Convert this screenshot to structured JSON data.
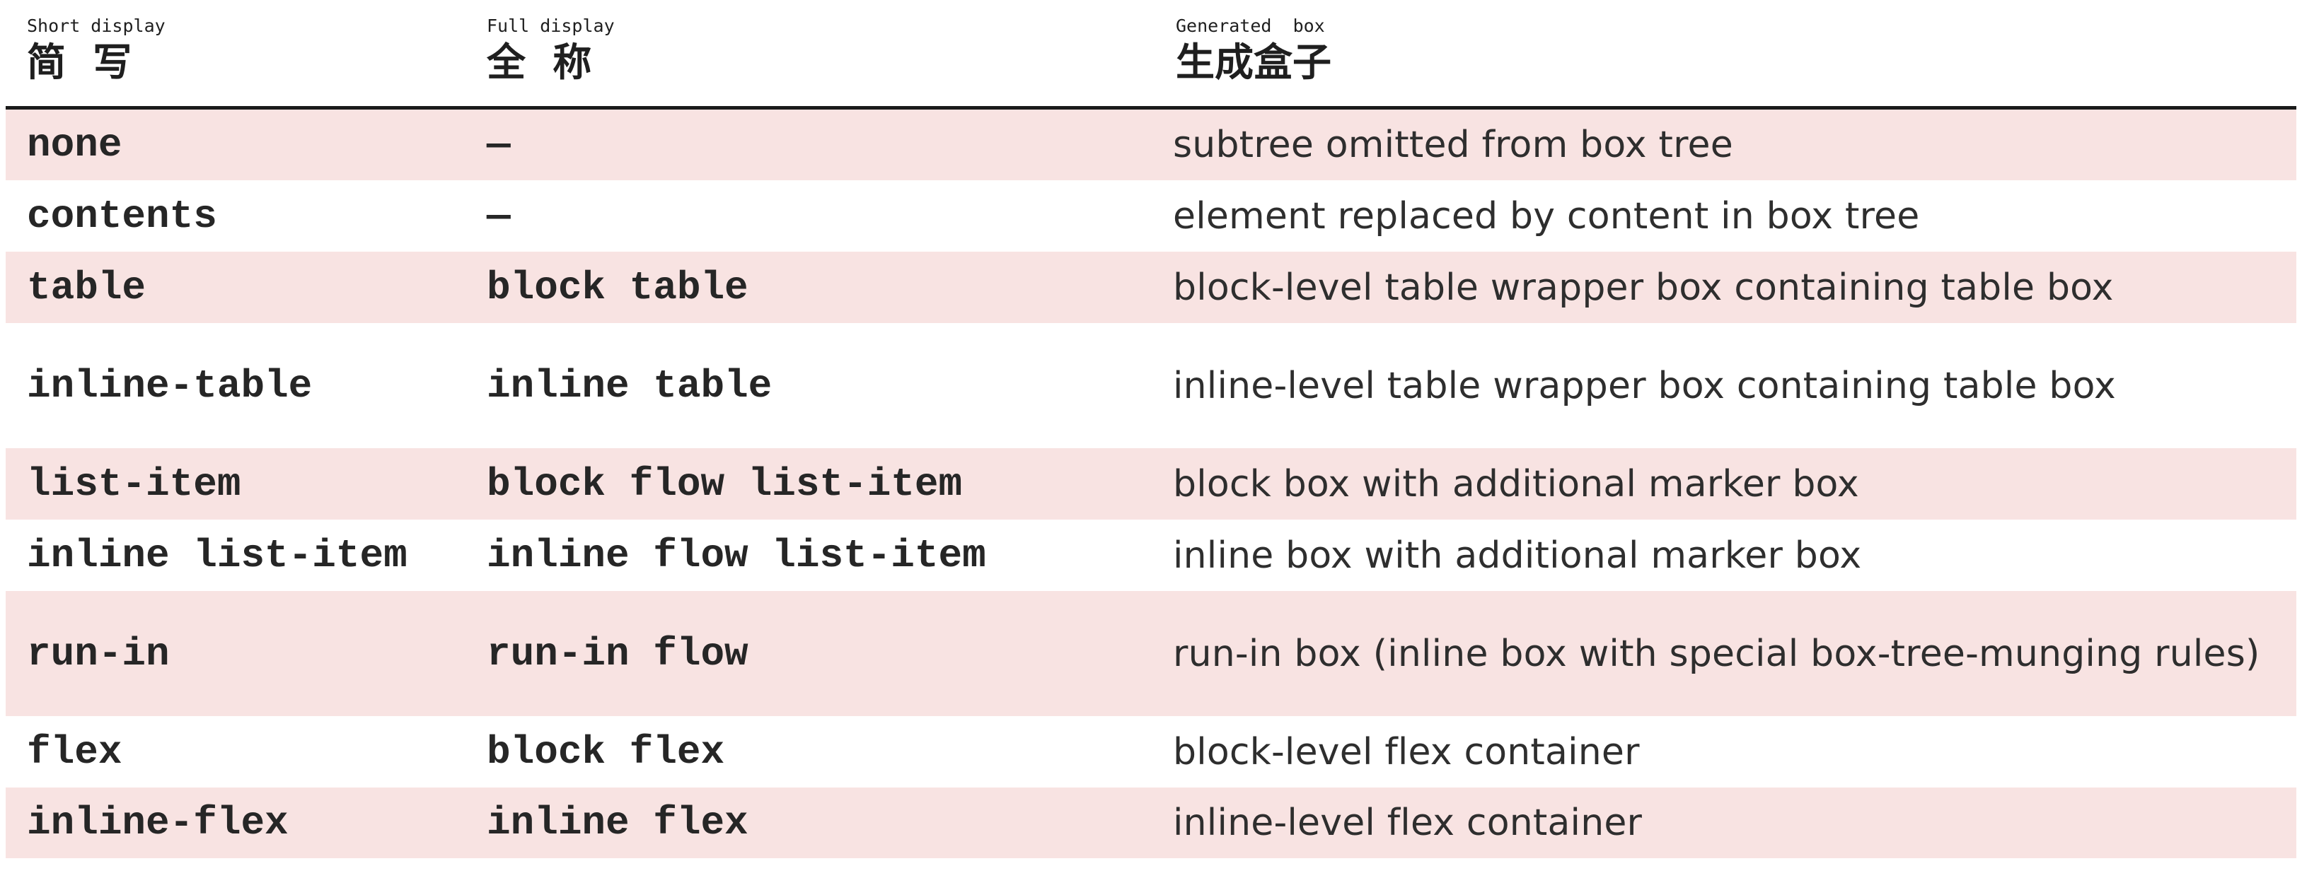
{
  "header": {
    "col1_small": "Short display",
    "col1_zh": "简  写",
    "col2_small": "Full display",
    "col2_zh": "全  称",
    "col3_small": "Generated  box",
    "col3_zh": "生成盒子"
  },
  "rows": [
    {
      "short": "none",
      "full": "—",
      "box": "subtree omitted from box tree"
    },
    {
      "short": "contents",
      "full": "—",
      "box": "element replaced by content in box tree"
    },
    {
      "short": "table",
      "full": "block table",
      "box": "block-level table wrapper box containing table box"
    },
    {
      "short": "inline-table",
      "full": "inline table",
      "box": "inline-level table wrapper box containing table box"
    },
    {
      "short": "list-item",
      "full": "block flow list-item",
      "box": "block box with additional marker box"
    },
    {
      "short": "inline list-item",
      "full": "inline flow list-item",
      "box": "inline box with additional marker box"
    },
    {
      "short": "run-in",
      "full": "run-in flow",
      "box": "run-in box (inline box with special box-tree-munging rules)"
    },
    {
      "short": "flex",
      "full": "block flex",
      "box": "block-level flex container"
    },
    {
      "short": "inline-flex",
      "full": "inline flex",
      "box": "inline-level flex container"
    }
  ],
  "colors": {
    "row_stripe": "#f8e3e2",
    "rule": "#1a1a1a"
  }
}
